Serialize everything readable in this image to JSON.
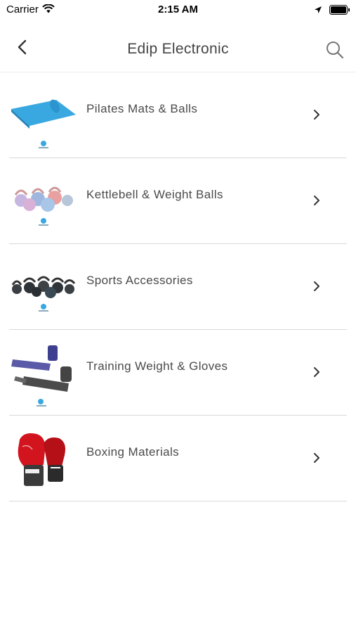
{
  "status_bar": {
    "carrier": "Carrier",
    "time": "2:15 AM"
  },
  "nav": {
    "title": "Edip Electronic",
    "back_icon": "chevron-left-icon",
    "search_icon": "search-icon"
  },
  "categories": [
    {
      "label": "Pilates Mats & Balls"
    },
    {
      "label": "Kettlebell & Weight Balls"
    },
    {
      "label": "Sports Accessories"
    },
    {
      "label": "Training Weight & Gloves"
    },
    {
      "label": "Boxing Materials"
    }
  ],
  "colors": {
    "accent": "#3aa8e0",
    "divider": "#d9d9d9",
    "title": "#444444"
  }
}
